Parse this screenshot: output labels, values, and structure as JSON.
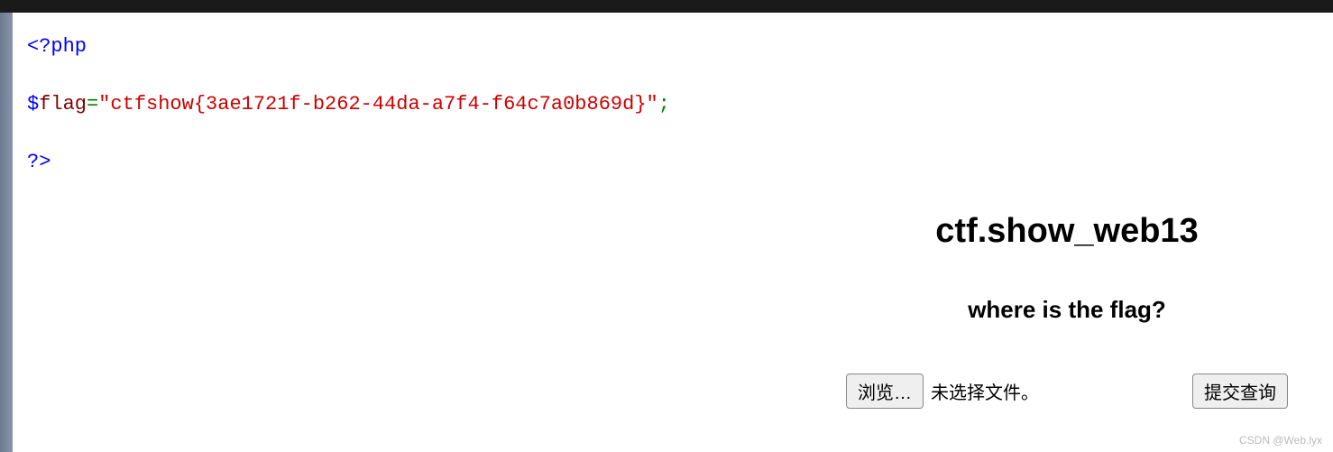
{
  "code": {
    "open_tag": "<?php",
    "var_dollar": "$",
    "var_name": "flag",
    "equals": "=",
    "string_open": "\"",
    "string_value": "ctfshow{3ae1721f-b262-44da-a7f4-f64c7a0b869d}",
    "string_close": "\"",
    "semicolon": ";",
    "close_tag": "?>"
  },
  "panel": {
    "title": "ctf.show_web13",
    "subtitle": "where is the flag?",
    "browse_label": "浏览…",
    "file_status": "未选择文件。",
    "submit_label": "提交查询"
  },
  "watermark": "CSDN @Web.lyx"
}
